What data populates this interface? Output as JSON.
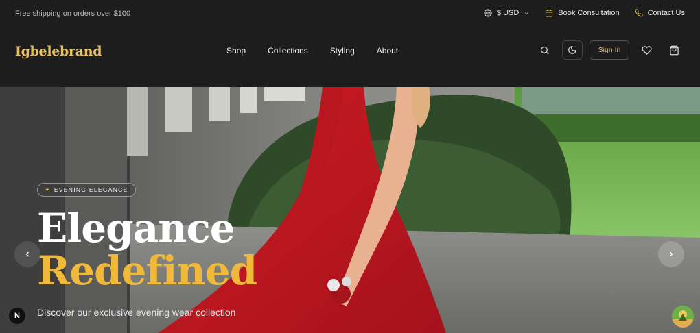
{
  "topbar": {
    "shipping": "Free shipping on orders over $100",
    "currency": "$ USD",
    "book": "Book Consultation",
    "contact": "Contact Us"
  },
  "brand": {
    "logo": "Igbelebrand"
  },
  "nav": {
    "shop": "Shop",
    "collections": "Collections",
    "styling": "Styling",
    "about": "About"
  },
  "actions": {
    "sign_in": "Sign In"
  },
  "hero": {
    "badge": "EVENING ELEGANCE",
    "title_line1": "Elegance",
    "title_line2": "Redefined",
    "subtitle": "Discover our exclusive evening wear collection"
  },
  "misc": {
    "n_badge": "N"
  },
  "colors": {
    "accent": "#e8c063",
    "title_gold": "#f0b93a",
    "header_bg": "#1d1d1d"
  }
}
